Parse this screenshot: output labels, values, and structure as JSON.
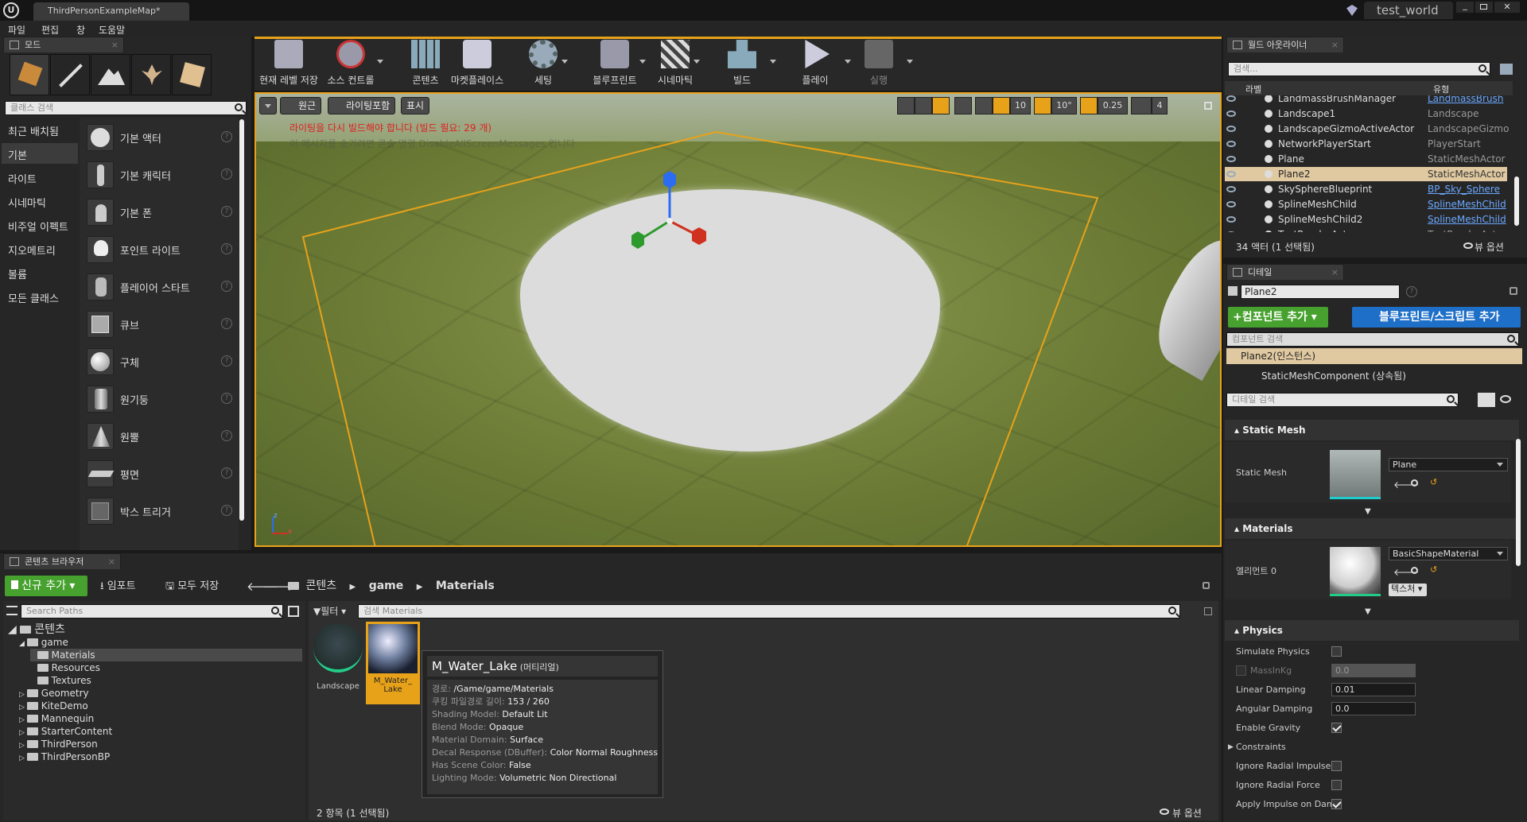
{
  "titlebar": {
    "tab_title": "ThirdPersonExampleMap*",
    "project_name": "test_world"
  },
  "menu": [
    "파일",
    "편집",
    "창",
    "도움말"
  ],
  "modes": {
    "tab_label": "모드",
    "search_placeholder": "클래스 검색",
    "categories": [
      "최근 배치됨",
      "기본",
      "라이트",
      "시네마틱",
      "비주얼 이펙트",
      "지오메트리",
      "볼륨",
      "모든 클래스"
    ],
    "items": [
      "기본 액터",
      "기본 캐릭터",
      "기본 폰",
      "포인트 라이트",
      "플레이어 스타트",
      "큐브",
      "구체",
      "원기둥",
      "원뿔",
      "평면",
      "박스 트리거"
    ]
  },
  "toolbar": {
    "buttons": [
      "현재 레벨 저장",
      "소스 컨트롤",
      "콘텐츠",
      "마켓플레이스",
      "세팅",
      "블루프린트",
      "시네마틱",
      "빌드",
      "플레이",
      "실행"
    ]
  },
  "viewport": {
    "perspective_label": "원근",
    "lighting_label": "라이팅포함",
    "show_label": "표시",
    "warning_text": "라이팅을 다시 빌드해야 합니다 (빌드 필요: 29 개)",
    "hint_text": "이 메시지를 숨기려면 콘솔 명령 DisableAllScreenMessages 입니다",
    "grid_snap": "10",
    "rot_snap": "10°",
    "scale_snap": "0.25",
    "camera_speed": "4"
  },
  "outliner": {
    "tab_label": "월드 아웃라이너",
    "search_placeholder": "검색...",
    "col_label": "라벨",
    "col_type": "유형",
    "rows": [
      {
        "name": "LandmassBrushManager",
        "type": "LandmassBrush",
        "link": true
      },
      {
        "name": "Landscape1",
        "type": "Landscape",
        "link": false
      },
      {
        "name": "LandscapeGizmoActiveActor",
        "type": "LandscapeGizmo",
        "link": false
      },
      {
        "name": "NetworkPlayerStart",
        "type": "PlayerStart",
        "link": false
      },
      {
        "name": "Plane",
        "type": "StaticMeshActor",
        "link": false
      },
      {
        "name": "Plane2",
        "type": "StaticMeshActor",
        "link": false
      },
      {
        "name": "SkySphereBlueprint",
        "type": "BP_Sky_Sphere",
        "link": true
      },
      {
        "name": "SplineMeshChild",
        "type": "SplineMeshChild",
        "link": true
      },
      {
        "name": "SplineMeshChild2",
        "type": "SplineMeshChild",
        "link": true
      },
      {
        "name": "TextRenderActor",
        "type": "TextRenderActor",
        "link": false
      }
    ],
    "footer": "34 액터 (1 선택됨)",
    "view_options": "뷰 옵션"
  },
  "details": {
    "tab_label": "디테일",
    "name_value": "Plane2",
    "add_component": "컴포넌트 추가",
    "blueprint_script": "블루프린트/스크립트 추가",
    "component_search": "컴포넌트 검색",
    "instance_label": "Plane2(인스턴스)",
    "component_label": "StaticMeshComponent (상속됨)",
    "detail_search": "디테일 검색",
    "static_mesh_section": "Static Mesh",
    "static_mesh_label": "Static Mesh",
    "static_mesh_value": "Plane",
    "materials_section": "Materials",
    "element_label": "엘리먼트 0",
    "material_value": "BasicShapeMaterial",
    "textures_btn": "텍스처",
    "physics_section": "Physics",
    "physics": [
      {
        "label": "Simulate Physics",
        "kind": "check",
        "checked": false
      },
      {
        "label": "MassInKg",
        "kind": "num",
        "value": "0.0",
        "disabled": true
      },
      {
        "label": "Linear Damping",
        "kind": "num",
        "value": "0.01"
      },
      {
        "label": "Angular Damping",
        "kind": "num",
        "value": "0.0"
      },
      {
        "label": "Enable Gravity",
        "kind": "check",
        "checked": true
      },
      {
        "label": "Constraints",
        "kind": "group"
      },
      {
        "label": "Ignore Radial Impulse",
        "kind": "check",
        "checked": false
      },
      {
        "label": "Ignore Radial Force",
        "kind": "check",
        "checked": false
      },
      {
        "label": "Apply Impulse on Dam",
        "kind": "check",
        "checked": true
      }
    ]
  },
  "content_browser": {
    "tab_label": "콘텐츠 브라우저",
    "add_new": "신규 추가",
    "import": "임포트",
    "save_all": "모두 저장",
    "breadcrumb": [
      "콘텐츠",
      "game",
      "Materials"
    ],
    "search_paths": "Search Paths",
    "filter": "필터",
    "search_materials": "검색 Materials",
    "tree_root": "콘텐츠",
    "tree": [
      {
        "label": "game",
        "indent": 1,
        "open": true
      },
      {
        "label": "Materials",
        "indent": 2,
        "selected": true
      },
      {
        "label": "Resources",
        "indent": 2
      },
      {
        "label": "Textures",
        "indent": 2
      },
      {
        "label": "Geometry",
        "indent": 1
      },
      {
        "label": "KiteDemo",
        "indent": 1
      },
      {
        "label": "Mannequin",
        "indent": 1
      },
      {
        "label": "StarterContent",
        "indent": 1
      },
      {
        "label": "ThirdPerson",
        "indent": 1
      },
      {
        "label": "ThirdPersonBP",
        "indent": 1
      }
    ],
    "assets": [
      "Landscape",
      "M_Water_\nLake"
    ],
    "footer": "2 항목 (1 선택됨)",
    "view_options": "뷰 옵션"
  },
  "tooltip": {
    "title": "M_Water_Lake",
    "kind": "(머티리얼)",
    "rows": [
      {
        "k": "경로:",
        "v": "/Game/game/Materials"
      },
      {
        "k": "쿠킹 파일경로 길이:",
        "v": "153 / 260"
      },
      {
        "k": "Shading Model:",
        "v": "Default Lit"
      },
      {
        "k": "Blend Mode:",
        "v": "Opaque"
      },
      {
        "k": "Material Domain:",
        "v": "Surface"
      },
      {
        "k": "Decal Response (DBuffer):",
        "v": "Color Normal Roughness"
      },
      {
        "k": "Has Scene Color:",
        "v": "False"
      },
      {
        "k": "Lighting Mode:",
        "v": "Volumetric Non Directional"
      }
    ]
  }
}
